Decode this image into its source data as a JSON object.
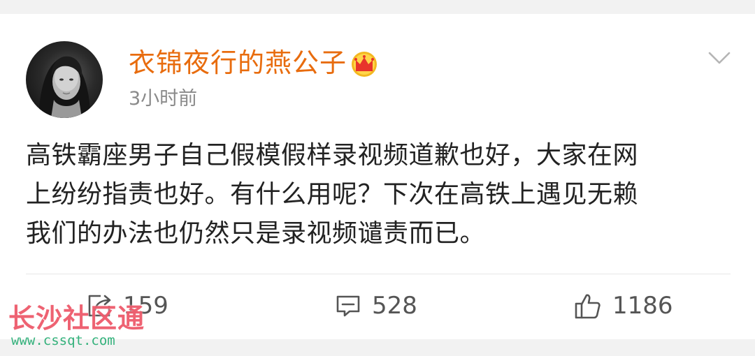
{
  "post": {
    "author": {
      "name": "衣锦夜行的燕公子",
      "badge_icon": "crown-icon"
    },
    "timestamp": "3小时前",
    "text_lines": [
      "高铁霸座男子自己假模假样录视频道歉也好，大家在网",
      "上纷纷指责也好。有什么用呢？下次在高铁上遇见无赖",
      "我们的办法也仍然只是录视频谴责而已。"
    ],
    "actions": {
      "repost": {
        "icon": "repost-icon",
        "count": "159"
      },
      "comment": {
        "icon": "comment-icon",
        "count": "528"
      },
      "like": {
        "icon": "thumbs-up-icon",
        "count": "1186"
      }
    },
    "menu_icon": "chevron-down-icon"
  },
  "watermark": {
    "title": "长沙社区通",
    "url": "www.cssqt.com"
  },
  "colors": {
    "username": "#e86c0e",
    "timestamp": "#8a8a8a",
    "body_text": "#222222",
    "action_text": "#555555",
    "watermark_title": "#ec4c5e",
    "watermark_url": "#1eaa6e"
  }
}
